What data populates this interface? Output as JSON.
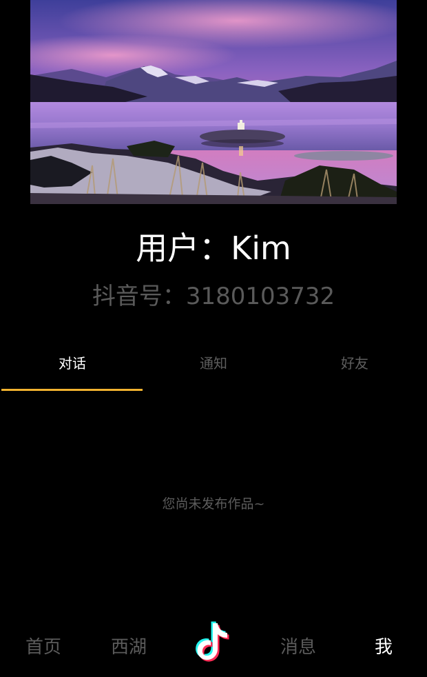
{
  "profile": {
    "username": "用户：Kim",
    "douyin_id": "抖音号：3180103732"
  },
  "tabs": [
    {
      "label": "对话",
      "active": true
    },
    {
      "label": "通知",
      "active": false
    },
    {
      "label": "好友",
      "active": false
    }
  ],
  "content": {
    "empty_message": "您尚未发布作品~"
  },
  "bottom_nav": {
    "items": [
      {
        "label": "首页",
        "active": false
      },
      {
        "label": "西湖",
        "active": false
      },
      {
        "label": "",
        "icon": "tiktok-logo-icon"
      },
      {
        "label": "消息",
        "active": false
      },
      {
        "label": "我",
        "active": true
      }
    ]
  },
  "colors": {
    "background": "#000000",
    "accent": "#f2b330",
    "inactive_text": "#5e5e5e"
  }
}
